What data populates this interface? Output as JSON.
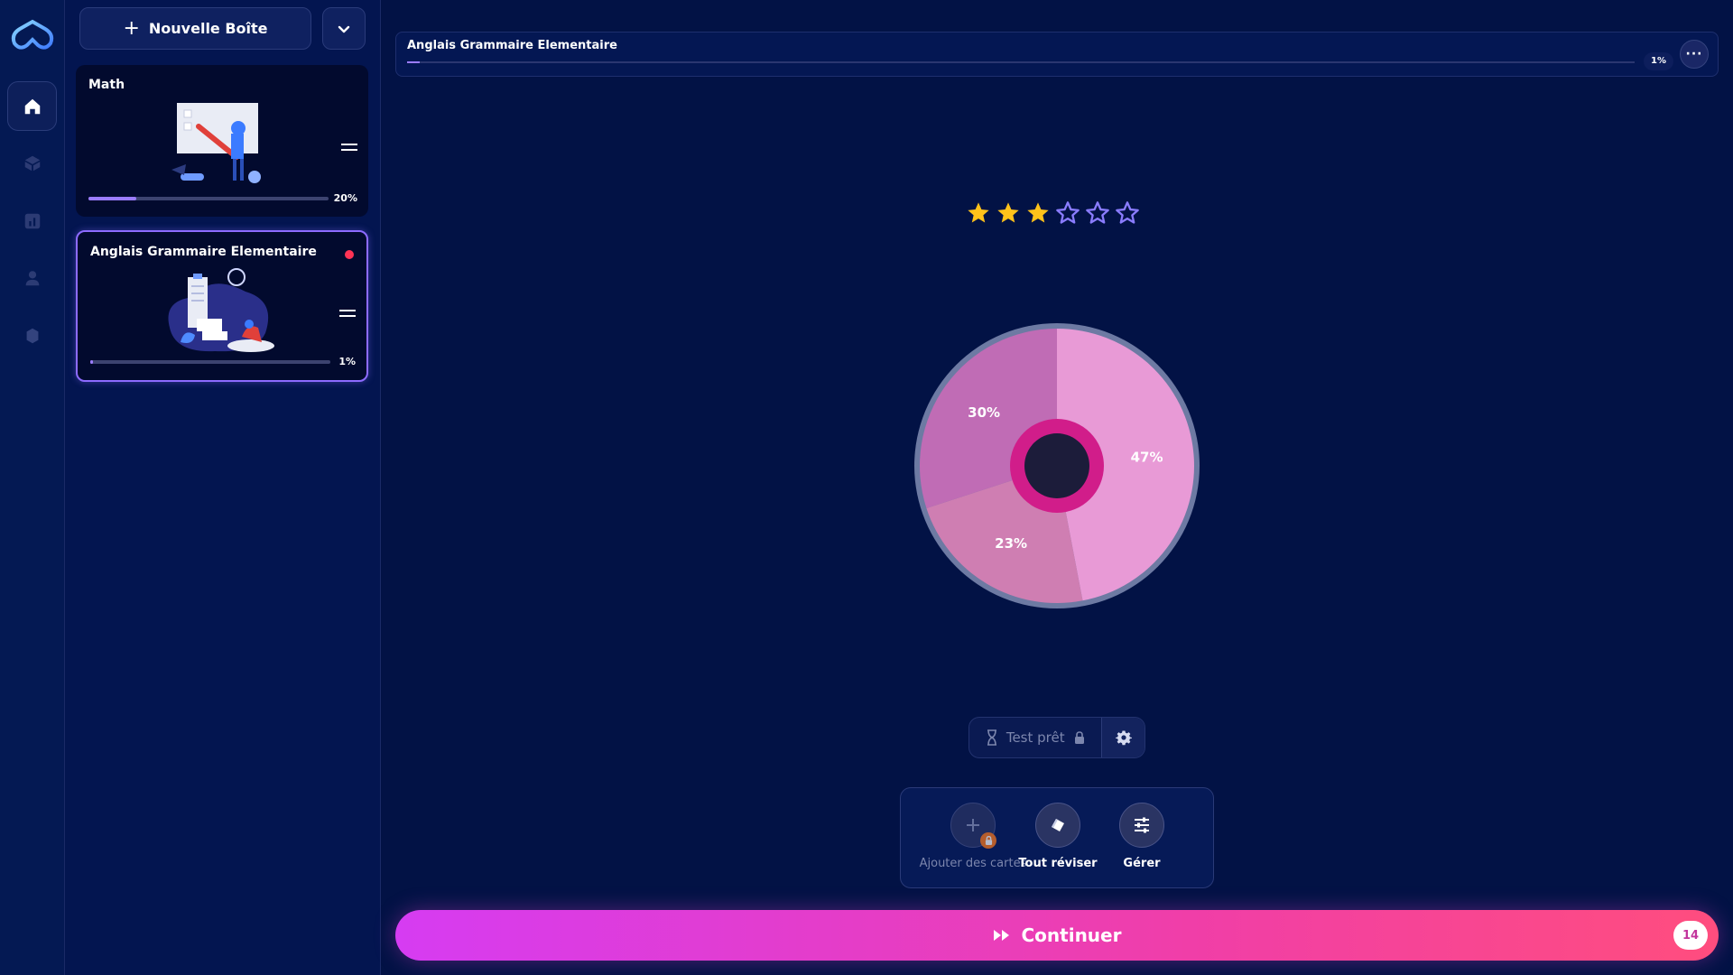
{
  "sidebar": {
    "new_box_label": "Nouvelle Boîte",
    "decks": [
      {
        "title": "Math",
        "progress": 20,
        "progress_label": "20%"
      },
      {
        "title": "Anglais Grammaire Elementaire",
        "progress": 1,
        "progress_label": "1%"
      }
    ]
  },
  "header": {
    "title": "Anglais Grammaire Elementaire",
    "progress": 1,
    "progress_label": "1%"
  },
  "rating": {
    "filled": 3,
    "total": 6
  },
  "chart_data": {
    "type": "pie",
    "slices": [
      {
        "label": "47%",
        "value": 47,
        "color": "#e89ad6"
      },
      {
        "label": "23%",
        "value": 23,
        "color": "#cf7eb2"
      },
      {
        "label": "30%",
        "value": 30,
        "color": "#c06cb5"
      }
    ]
  },
  "test": {
    "label": "Test prêt"
  },
  "actions": {
    "add_cards": "Ajouter des cartes",
    "review_all": "Tout réviser",
    "manage": "Gérer"
  },
  "continue": {
    "label": "Continuer",
    "count": "14"
  },
  "colors": {
    "background": "#021245",
    "accent": "#9b7cff",
    "star": "#ffc21a",
    "continue_start": "#d63cf2",
    "continue_end": "#ff4d7e"
  }
}
